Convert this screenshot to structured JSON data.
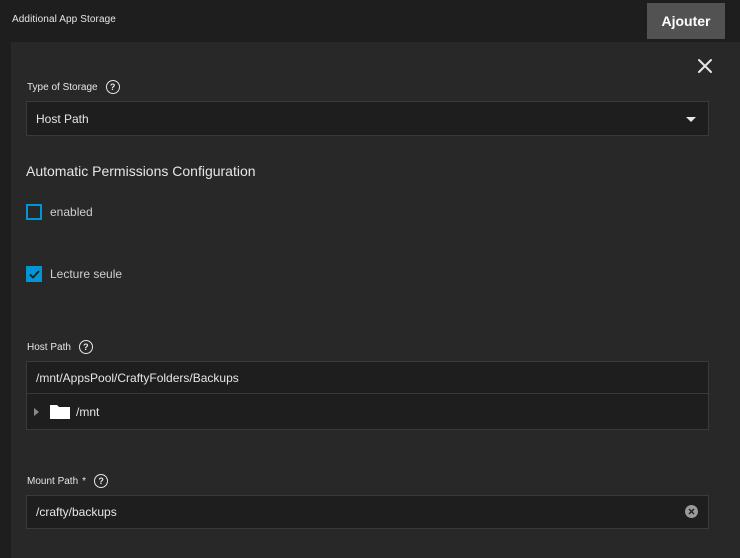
{
  "header": {
    "title": "Additional App Storage",
    "add_label": "Ajouter"
  },
  "form": {
    "close_icon": "close-icon",
    "type_of_storage": {
      "label": "Type of Storage",
      "value": "Host Path"
    },
    "permissions_section": {
      "title": "Automatic Permissions Configuration"
    },
    "enabled": {
      "label": "enabled",
      "checked": false
    },
    "read_only": {
      "label": "Lecture seule",
      "checked": true
    },
    "host_path": {
      "label": "Host Path",
      "value": "/mnt/AppsPool/CraftyFolders/Backups",
      "tree_root": "/mnt"
    },
    "mount_path": {
      "label": "Mount Path",
      "required_marker": "*",
      "value": "/crafty/backups"
    }
  },
  "colors": {
    "accent": "#0095d5",
    "background": "#1e1e1e",
    "panel": "#282828",
    "button": "#525252"
  }
}
